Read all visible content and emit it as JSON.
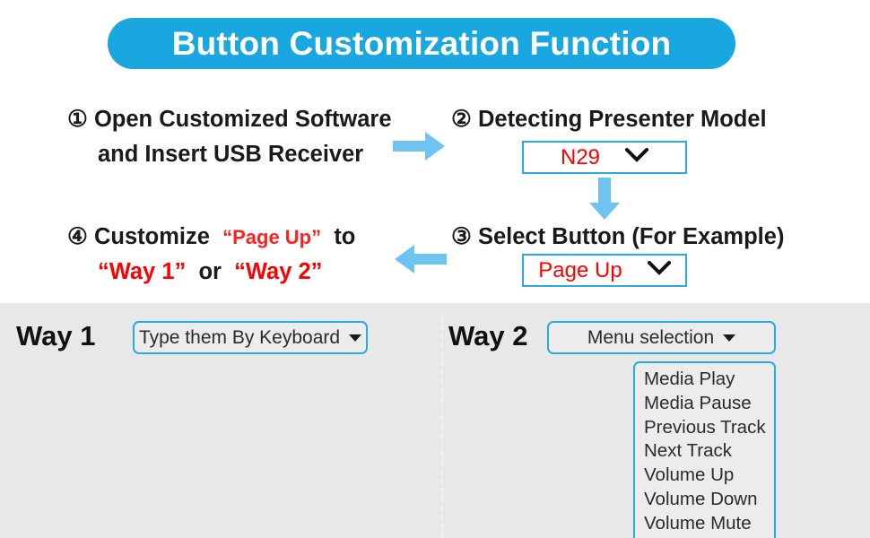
{
  "header": {
    "title": "Button Customization Function",
    "banner_color": "#19A7E0"
  },
  "steps": [
    {
      "number": "①",
      "line1": "Open Customized Software",
      "line2": "and Insert USB Receiver"
    },
    {
      "number": "②",
      "line1": "Detecting Presenter Model",
      "select": {
        "name": "presenter-model-select",
        "value": "N29",
        "value_color": "#ff0000",
        "border_color": "#29ABE2"
      }
    },
    {
      "number": "③",
      "line1": "Select Button (For Example)",
      "select": {
        "name": "button-select",
        "value": "Page Up",
        "value_color": "#ff0000",
        "border_color": "#29ABE2"
      }
    },
    {
      "number": "④",
      "line1_a": "Customize",
      "line1_quoted": "“Page Up”",
      "line1_b": "to",
      "line2_q1": "“Way 1”",
      "line2_or": "or",
      "line2_q2": "“Way 2”"
    }
  ],
  "arrows": {
    "step1_to_step2": "arrow-right",
    "step2_to_step3": "arrow-down",
    "step3_to_step4": "arrow-left",
    "color": "#6FC3F0"
  },
  "bottom": {
    "background": "#e8e8e8",
    "way1": {
      "label": "Way 1",
      "dropdown_label": "Type them By Keyboard"
    },
    "way2": {
      "label": "Way 2",
      "dropdown_label": "Menu selection",
      "menu_items": [
        "Media Play",
        "Media Pause",
        "Previous Track",
        "Next Track",
        "Volume Up",
        "Volume Down",
        "Volume Mute"
      ]
    }
  }
}
